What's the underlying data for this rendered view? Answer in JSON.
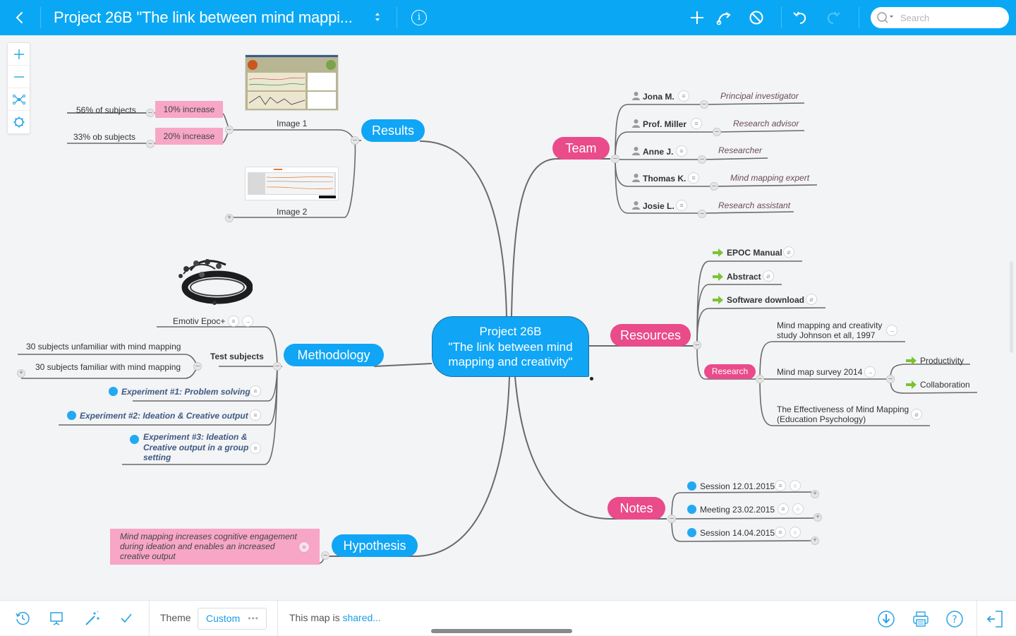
{
  "app": {
    "title": "Project 26B \"The link between mind mappi...",
    "search_placeholder": "Search"
  },
  "toolbar": {
    "back": "back",
    "icons": [
      "add-topic",
      "add-relation",
      "remove",
      "undo",
      "redo"
    ]
  },
  "zoom_controls": [
    "zoom-in",
    "zoom-out",
    "fit-map",
    "settings"
  ],
  "map": {
    "central": {
      "line1": "Project 26B",
      "line2": "\"The link between mind",
      "line3": "mapping and creativity\""
    },
    "results": {
      "label": "Results",
      "image1_caption": "Image 1",
      "image2_caption": "Image 2",
      "children": [
        {
          "label": "10% increase",
          "detail": "56% of subjects"
        },
        {
          "label": "20% increase",
          "detail": "33% ob subjects"
        }
      ]
    },
    "team": {
      "label": "Team",
      "members": [
        {
          "name": "Jona M.",
          "role": "Principal investigator"
        },
        {
          "name": "Prof. Miller",
          "role": "Research advisor"
        },
        {
          "name": "Anne J.",
          "role": "Researcher"
        },
        {
          "name": "Thomas K.",
          "role": "Mind mapping expert"
        },
        {
          "name": "Josie L.",
          "role": "Research assistant"
        }
      ]
    },
    "resources": {
      "label": "Resources",
      "links": [
        "EPOC Manual",
        "Abstract",
        "Software download"
      ],
      "research": {
        "label": "Research",
        "items": [
          {
            "line1": "Mind mapping and creativity",
            "line2": "study Johnson et all, 1997"
          },
          {
            "line1": "Mind map survey 2014",
            "children": [
              "Productivity",
              "Collaboration"
            ]
          },
          {
            "line1": "The Effectiveness of Mind Mapping",
            "line2": "(Education Psychology)"
          }
        ]
      }
    },
    "methodology": {
      "label": "Methodology",
      "device": "Emotiv Epoc+",
      "test_subjects": {
        "label": "Test subjects",
        "children": [
          "30 subjects unfamiliar with mind mapping",
          "30 subjects familiar with mind mapping"
        ]
      },
      "experiments": [
        {
          "lines": [
            "Experiment #1: Problem solving"
          ]
        },
        {
          "lines": [
            "Experiment #2: Ideation & Creative output"
          ]
        },
        {
          "lines": [
            "Experiment #3: Ideation &",
            "Creative output in a group",
            "setting"
          ]
        }
      ]
    },
    "notes": {
      "label": "Notes",
      "items": [
        "Session 12.01.2015",
        "Meeting 23.02.2015",
        "Session 14.04.2015"
      ]
    },
    "hypothesis": {
      "label": "Hypothesis",
      "text": [
        "Mind mapping increases cognitive engagement",
        "during ideation and enables an increased",
        "creative output"
      ]
    }
  },
  "bottombar": {
    "theme_label": "Theme",
    "theme_value": "Custom",
    "theme_more": "•••",
    "share_prefix": "This map is ",
    "share_link": "shared..."
  },
  "colors": {
    "accent": "#0aa8f4",
    "topic_blue": "#10a5f5",
    "topic_pink": "#ea4b8a",
    "callout_pink": "#f7a6c6"
  }
}
